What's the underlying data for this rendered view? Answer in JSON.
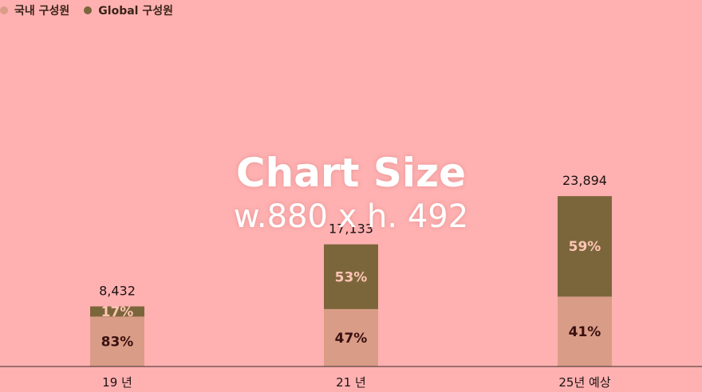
{
  "legend": {
    "domestic_label": "국내 구성원",
    "global_label": "Global 구성원"
  },
  "colors": {
    "background": "#ffb1b1",
    "domestic": "#d99c86",
    "global": "#7b663b",
    "domestic_text": "#3a1010",
    "global_text": "#ffc5b5",
    "total_text": "#1e1212",
    "axis": "#3a2a2a"
  },
  "watermark": {
    "line1": "Chart Size",
    "line2": "w.880 x h. 492"
  },
  "chart_data": {
    "type": "bar",
    "stacked": true,
    "categories": [
      "19 년",
      "21 년",
      "25년 예상"
    ],
    "totals": [
      8432,
      17133,
      23894
    ],
    "total_labels": [
      "8,432",
      "17,133",
      "23,894"
    ],
    "series": [
      {
        "name": "국내 구성원",
        "values": [
          83,
          47,
          41
        ],
        "labels": [
          "83%",
          "47%",
          "41%"
        ]
      },
      {
        "name": "Global 구성원",
        "values": [
          17,
          53,
          59
        ],
        "labels": [
          "17%",
          "53%",
          "59%"
        ]
      }
    ],
    "ylim": [
      0,
      25000
    ],
    "grid": false,
    "legend_position": "top-left"
  }
}
